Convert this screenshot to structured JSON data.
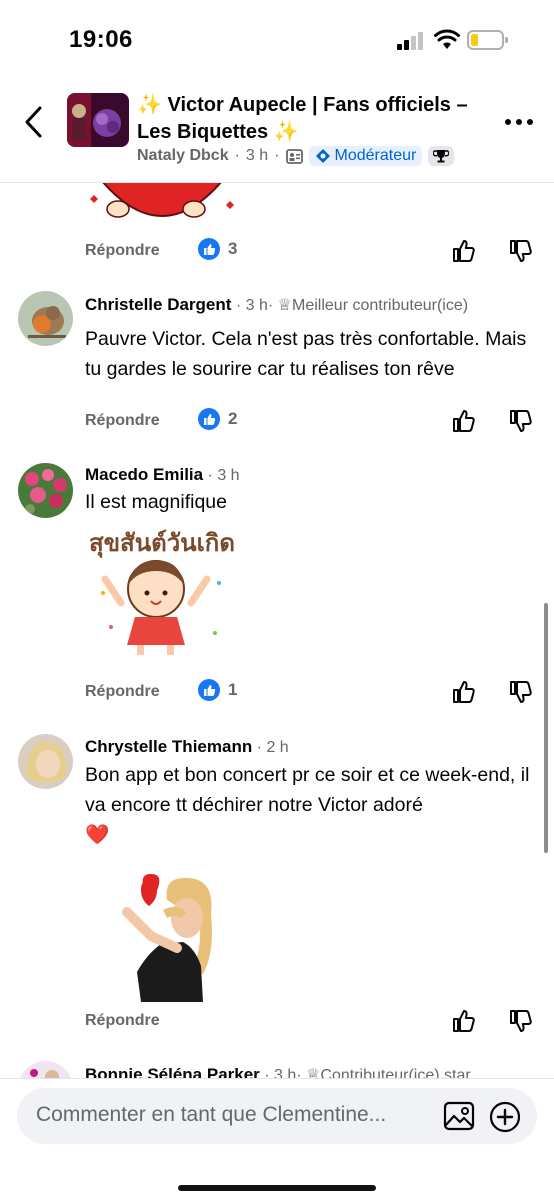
{
  "status": {
    "time": "19:06"
  },
  "header": {
    "title_sparkle_left": "✨",
    "title": "Victor Aupecle | Fans officiels – Les Biquettes",
    "title_sparkle_right": "✨",
    "author": "Nataly Dbck",
    "time": "3 h",
    "sep": "·",
    "badge": "Modérateur"
  },
  "top_actions": {
    "reply": "Répondre",
    "likes": "3"
  },
  "comments": [
    {
      "name": "Christelle Dargent",
      "meta": " · 3 h· ",
      "role": "Meilleur contributeur(ice)",
      "text": "Pauvre Victor. Cela n'est pas très confortable. Mais tu gardes le sourire car tu réalises ton rêve",
      "reply": "Répondre",
      "likes": "2"
    },
    {
      "name": "Macedo Emilia",
      "meta": " · 3 h",
      "text": "Il est  magnifique",
      "sticker_text": "สุขสันต์วันเกิด",
      "reply": "Répondre",
      "likes": "1"
    },
    {
      "name": "Chrystelle Thiemann",
      "meta": " · 2 h",
      "text": "Bon app et bon concert pr ce soir et ce week-end, il va encore tt déchirer notre Victor adoré",
      "emoji": "❤️",
      "reply": "Répondre"
    },
    {
      "name": "Bonnie Séléna Parker",
      "meta": " · 3 h· ",
      "role": "Contributeur(ice) star"
    }
  ],
  "composer": {
    "placeholder": "Commenter en tant que Clementine..."
  },
  "colors": {
    "accent": "#1877f2",
    "secondary_text": "#65676b",
    "heart": "#e02424"
  }
}
